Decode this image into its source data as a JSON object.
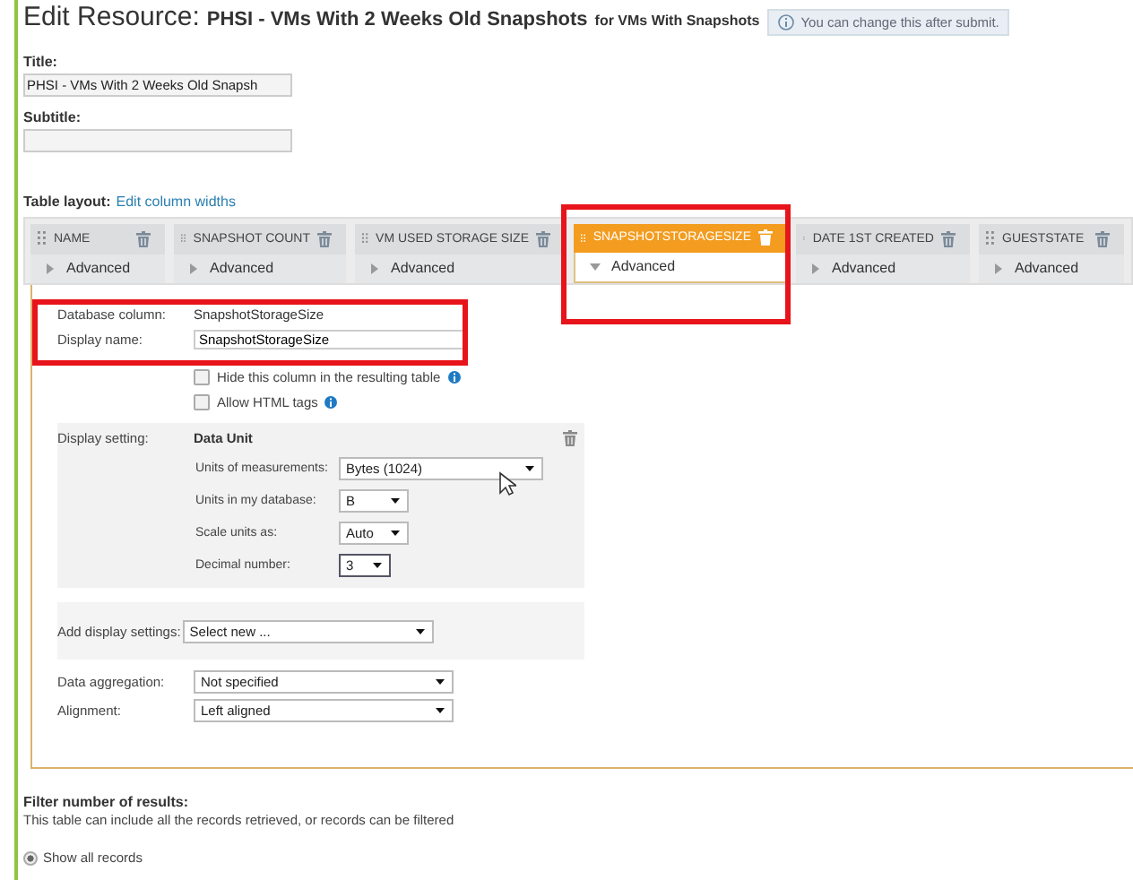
{
  "header": {
    "title": "Edit Resource:",
    "resource": "PHSI - VMs With 2 Weeks Old Snapshots",
    "context": "for VMs With Snapshots",
    "note": "You can change this after submit."
  },
  "title_field": {
    "label": "Title:",
    "value": "PHSI - VMs With 2 Weeks Old Snapsh"
  },
  "subtitle_field": {
    "label": "Subtitle:"
  },
  "table_layout": {
    "label": "Table layout:",
    "link": "Edit column widths"
  },
  "columns": [
    {
      "name": "NAME",
      "advanced": "Advanced",
      "selected": false
    },
    {
      "name": "SNAPSHOT COUNT",
      "advanced": "Advanced",
      "selected": false
    },
    {
      "name": "VM USED STORAGE SIZE",
      "advanced": "Advanced",
      "selected": false
    },
    {
      "name": "SNAPSHOTSTORAGESIZE",
      "advanced": "Advanced",
      "selected": true
    },
    {
      "name": "DATE 1ST CREATED",
      "advanced": "Advanced",
      "selected": false
    },
    {
      "name": "GUESTSTATE",
      "advanced": "Advanced",
      "selected": false
    }
  ],
  "details": {
    "database_column": {
      "label": "Database column:",
      "value": "SnapshotStorageSize"
    },
    "display_name": {
      "label": "Display name:",
      "value": "SnapshotStorageSize"
    },
    "checkboxes": [
      {
        "label": "Hide this column in the resulting table",
        "checked": false
      },
      {
        "label": "Allow HTML tags",
        "checked": false
      }
    ],
    "display_setting": {
      "label": "Display setting:",
      "name": "Data Unit",
      "fields": [
        {
          "label": "Units of measurements:",
          "value": "Bytes (1024)"
        },
        {
          "label": "Units in my database:",
          "value": "B"
        },
        {
          "label": "Scale units as:",
          "value": "Auto"
        },
        {
          "label": "Decimal number:",
          "value": "3"
        }
      ]
    },
    "add_display": {
      "label": "Add display settings:",
      "value": "Select new ..."
    },
    "selects": [
      {
        "label": "Data aggregation:",
        "value": "Not specified"
      },
      {
        "label": "Alignment:",
        "value": "Left aligned"
      }
    ]
  },
  "filter": {
    "title": "Filter number of results:",
    "description": "This table can include all the records retrieved, or records can be filtered",
    "options": [
      {
        "label": "Show all records",
        "selected": true
      }
    ]
  }
}
